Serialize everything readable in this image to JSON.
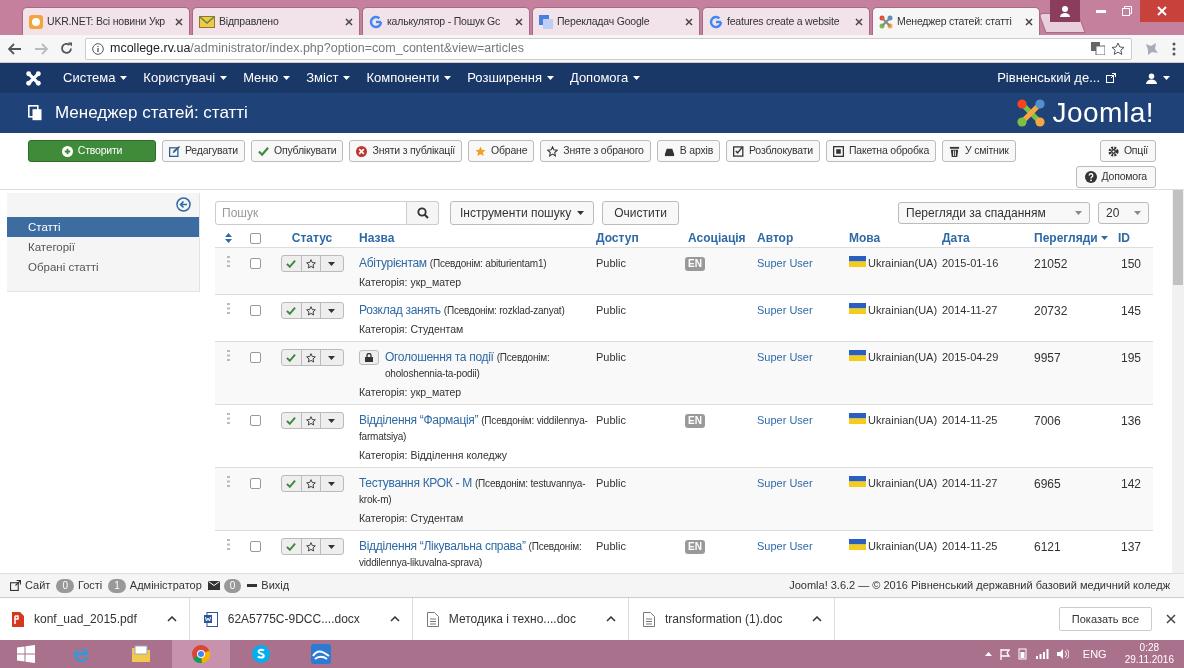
{
  "browser": {
    "tabs": [
      {
        "title": "UKR.NET: Всі новини Укр",
        "kind": "orange",
        "selected": false
      },
      {
        "title": "Відправлено",
        "kind": "mail",
        "selected": false
      },
      {
        "title": "калькулятор - Пошук Gc",
        "kind": "g",
        "selected": false
      },
      {
        "title": "Перекладач Google",
        "kind": "translate",
        "selected": false
      },
      {
        "title": "features create a website",
        "kind": "g",
        "selected": false
      },
      {
        "title": "Менеджер статей: статті",
        "kind": "joomla",
        "selected": true
      }
    ],
    "address": {
      "host": "mcollege.rv.ua",
      "path": "/administrator/index.php?option=com_content&view=articles"
    }
  },
  "nav": {
    "items": [
      "Система",
      "Користувачі",
      "Меню",
      "Зміст",
      "Компоненти",
      "Розширення",
      "Допомога"
    ],
    "site_link": "Рівненський де..."
  },
  "header": {
    "title": "Менеджер статей: статті",
    "logo_text": "Joomla!"
  },
  "toolbar": {
    "buttons": [
      {
        "label": "Створити",
        "kind": "plus"
      },
      {
        "label": "Редагувати",
        "kind": "edit"
      },
      {
        "label": "Опублікувати",
        "kind": "check"
      },
      {
        "label": "Зняти з публікації",
        "kind": "unpublish"
      },
      {
        "label": "Обране",
        "kind": "star"
      },
      {
        "label": "Зняте з обраного",
        "kind": "star-empty"
      },
      {
        "label": "В архів",
        "kind": "archive"
      },
      {
        "label": "Розблокувати",
        "kind": "checkbox"
      },
      {
        "label": "Пакетна обробка",
        "kind": "square"
      },
      {
        "label": "У смітник",
        "kind": "trash"
      },
      {
        "label": "Опції",
        "kind": "gear"
      }
    ],
    "help_button": "Допомога"
  },
  "sidebar": {
    "items": [
      {
        "label": "Статті",
        "selected": true
      },
      {
        "label": "Категорії",
        "selected": false
      },
      {
        "label": "Обрані статті",
        "selected": false
      }
    ]
  },
  "filters": {
    "search_placeholder": "Пошук",
    "tools_button": "Інструменти пошуку",
    "clear_button": "Очистити",
    "sort": "Перегляди за спаданням",
    "limit": "20"
  },
  "table": {
    "select_all_checked": false,
    "columns": [
      {
        "label": "Статус",
        "sorted": false
      },
      {
        "label": "Назва",
        "sorted": false
      },
      {
        "label": "Доступ",
        "sorted": false
      },
      {
        "label": "Асоціація",
        "sorted": false
      },
      {
        "label": "Автор",
        "sorted": false
      },
      {
        "label": "Мова",
        "sorted": false
      },
      {
        "label": "Дата",
        "sorted": false
      },
      {
        "label": "Перегляди",
        "sorted": true
      },
      {
        "label": "ID",
        "sorted": false
      }
    ],
    "rows": [
      {
        "checked": false,
        "title": "Абітурієнтам",
        "alias": "(Псевдонім: abiturientam1)",
        "category": "Категорія: укр_матер",
        "locked": false,
        "published": true,
        "featured": false,
        "access": "Public",
        "association": "EN",
        "author": "Super User",
        "language": "Ukrainian(UA)",
        "date": "2015-01-16",
        "views": "21052",
        "id": "150"
      },
      {
        "checked": false,
        "title": "Розклад занять",
        "alias": "(Псевдонім: rozklad-zanyat)",
        "category": "Категорія: Студентам",
        "locked": false,
        "published": true,
        "featured": false,
        "access": "Public",
        "author": "Super User",
        "language": "Ukrainian(UA)",
        "date": "2014-11-27",
        "views": "20732",
        "id": "145"
      },
      {
        "checked": false,
        "title": "Оголошення та події",
        "alias": "(Псевдонім: oholoshennia-ta-podii)",
        "category": "Категорія: укр_матер",
        "locked": true,
        "published": true,
        "featured": false,
        "access": "Public",
        "author": "Super User",
        "language": "Ukrainian(UA)",
        "date": "2015-04-29",
        "views": "9957",
        "id": "195"
      },
      {
        "checked": false,
        "title": "Відділення “Фармація”",
        "alias": "(Псевдонім: viddilennya-farmatsiya)",
        "category": "Категорія: Відділення коледжу",
        "locked": false,
        "published": true,
        "featured": false,
        "access": "Public",
        "association": "EN",
        "author": "Super User",
        "language": "Ukrainian(UA)",
        "date": "2014-11-25",
        "views": "7006",
        "id": "136"
      },
      {
        "checked": false,
        "title": "Тестування КРОК - М",
        "alias": "(Псевдонім: testuvannya-krok-m)",
        "category": "Категорія: Студентам",
        "locked": false,
        "published": true,
        "featured": false,
        "access": "Public",
        "author": "Super User",
        "language": "Ukrainian(UA)",
        "date": "2014-11-27",
        "views": "6965",
        "id": "142"
      },
      {
        "checked": false,
        "title": "Відділення “Лікувальна справа”",
        "alias": "(Псевдонім: viddilennya-likuvalna-sprava)",
        "locked": false,
        "published": true,
        "featured": false,
        "access": "Public",
        "association": "EN",
        "author": "Super User",
        "language": "Ukrainian(UA)",
        "date": "2014-11-25",
        "views": "6121",
        "id": "137"
      }
    ]
  },
  "status_bar": {
    "items": [
      {
        "kind": "link",
        "label": "Сайт"
      },
      {
        "kind": "count",
        "count": "0",
        "label": "Гості"
      },
      {
        "kind": "count",
        "count": "1",
        "label": "Адміністратор"
      },
      {
        "kind": "messages",
        "count": "0"
      },
      {
        "kind": "logout",
        "label": "Вихід"
      }
    ],
    "copyright": "Joomla! 3.6.2 — © 2016 Рівненський державний базовий медичний коледж"
  },
  "downloads": {
    "items": [
      {
        "name": "konf_uad_2015.pdf",
        "kind": "pdf"
      },
      {
        "name": "62A5775C-9DCC....docx",
        "kind": "word"
      },
      {
        "name": "Методика і техно....doc",
        "kind": "doc"
      },
      {
        "name": "transformation (1).doc",
        "kind": "doc"
      }
    ],
    "show_all": "Показать все"
  },
  "taskbar": {
    "apps": [
      {
        "kind": "ie",
        "selected": false
      },
      {
        "kind": "folder",
        "selected": false
      },
      {
        "kind": "chrome",
        "selected": true
      },
      {
        "kind": "skype",
        "selected": false
      },
      {
        "kind": "app",
        "selected": false
      }
    ],
    "language": "ENG",
    "time": "0:28",
    "date": "29.11.2016"
  }
}
